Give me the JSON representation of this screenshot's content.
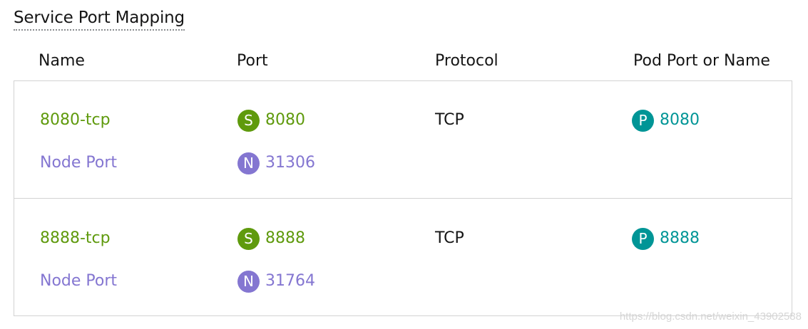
{
  "section": {
    "title": "Service Port Mapping"
  },
  "table": {
    "headers": [
      "Name",
      "Port",
      "Protocol",
      "Pod Port or Name"
    ],
    "rows": [
      {
        "name": "8080-tcp",
        "service_badge": "S",
        "service_port": "8080",
        "protocol": "TCP",
        "pod_badge": "P",
        "pod_port": "8080",
        "node_label": "Node Port",
        "node_badge": "N",
        "node_port": "31306"
      },
      {
        "name": "8888-tcp",
        "service_badge": "S",
        "service_port": "8888",
        "protocol": "TCP",
        "pod_badge": "P",
        "pod_port": "8888",
        "node_label": "Node Port",
        "node_badge": "N",
        "node_port": "31764"
      }
    ]
  },
  "colors": {
    "service": "#5f9a0d",
    "node": "#8476d1",
    "pod": "#009596",
    "text": "#151515",
    "border": "#d2d2d2"
  },
  "watermark": "https://blog.csdn.net/weixin_43902588"
}
